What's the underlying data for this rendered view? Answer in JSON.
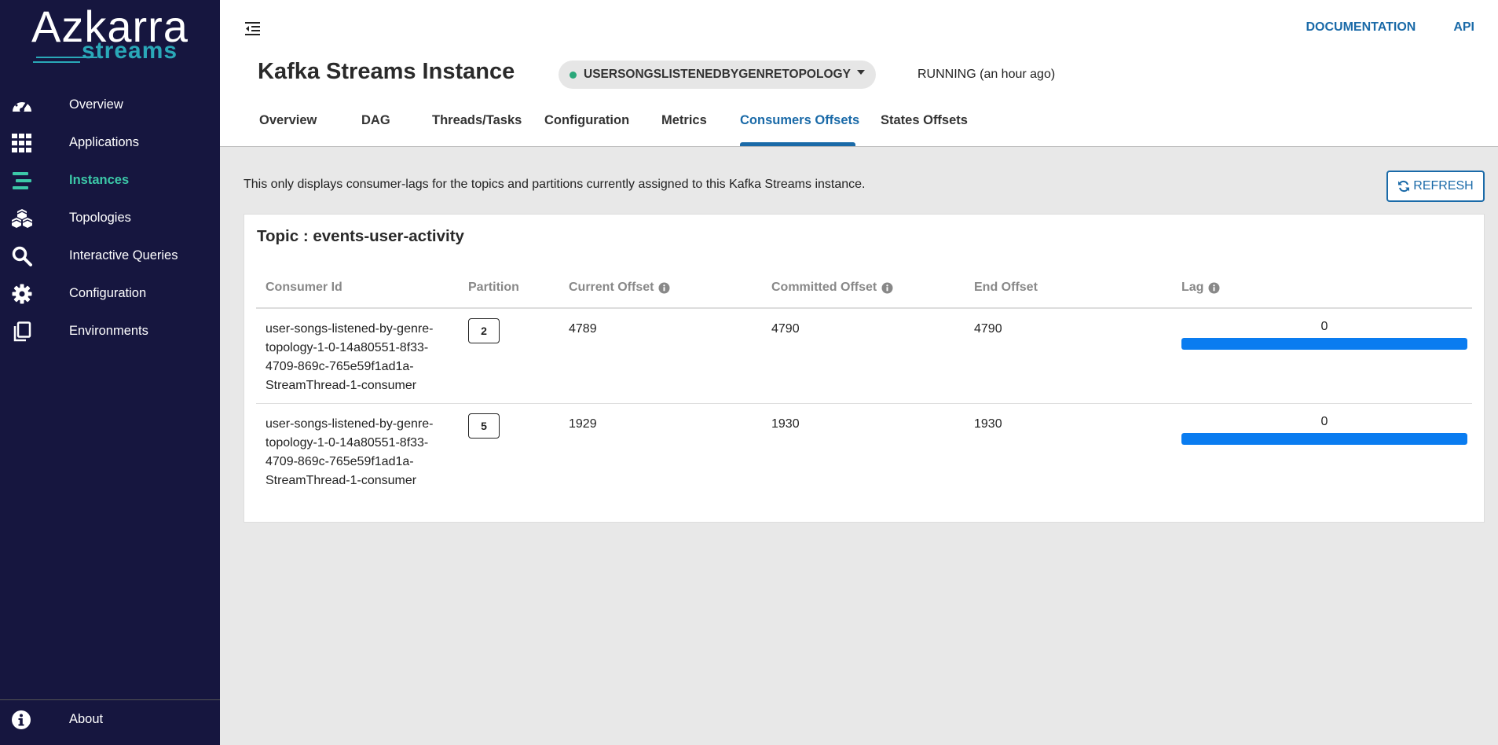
{
  "brand": {
    "name": "Azkarra",
    "sub": "streams"
  },
  "sidebar": {
    "items": [
      {
        "label": "Overview",
        "icon": "speedometer-icon"
      },
      {
        "label": "Applications",
        "icon": "grid-icon"
      },
      {
        "label": "Instances",
        "icon": "stream-icon",
        "active": true
      },
      {
        "label": "Topologies",
        "icon": "cubes-icon"
      },
      {
        "label": "Interactive Queries",
        "icon": "search-icon"
      },
      {
        "label": "Configuration",
        "icon": "gear-icon"
      },
      {
        "label": "Environments",
        "icon": "copy-icon"
      }
    ],
    "footer": {
      "label": "About",
      "icon": "info-circle-icon"
    }
  },
  "header": {
    "links": {
      "documentation": "DOCUMENTATION",
      "api": "API"
    },
    "title": "Kafka Streams Instance",
    "instance": "USERSONGSLISTENEDBYGENRETOPOLOGY",
    "status": "RUNNING (an hour ago)",
    "tabs": [
      "Overview",
      "DAG",
      "Threads/Tasks",
      "Configuration",
      "Metrics",
      "Consumers Offsets",
      "States Offsets"
    ],
    "active_tab": "Consumers Offsets"
  },
  "main": {
    "info": "This only displays consumer-lags for the topics and partitions currently assigned to this Kafka Streams instance.",
    "refresh_label": "REFRESH",
    "topic_title": "Topic : events-user-activity",
    "columns": [
      "Consumer Id",
      "Partition",
      "Current Offset",
      "Committed Offset",
      "End Offset",
      "Lag"
    ],
    "rows": [
      {
        "consumer_id": "user-songs-listened-by-genre-topology-1-0-14a80551-8f33-4709-869c-765e59f1ad1a-StreamThread-1-consumer",
        "partition": "2",
        "current_offset": "4789",
        "committed_offset": "4790",
        "end_offset": "4790",
        "lag": "0",
        "lag_progress": 1.0
      },
      {
        "consumer_id": "user-songs-listened-by-genre-topology-1-0-14a80551-8f33-4709-869c-765e59f1ad1a-StreamThread-1-consumer",
        "partition": "5",
        "current_offset": "1929",
        "committed_offset": "1930",
        "end_offset": "1930",
        "lag": "0",
        "lag_progress": 1.0
      }
    ]
  },
  "colors": {
    "sidebar_bg": "#16163f",
    "accent": "#1a6aa8",
    "active_nav": "#3cc8a8",
    "lag_bar": "#0a7cf0"
  }
}
